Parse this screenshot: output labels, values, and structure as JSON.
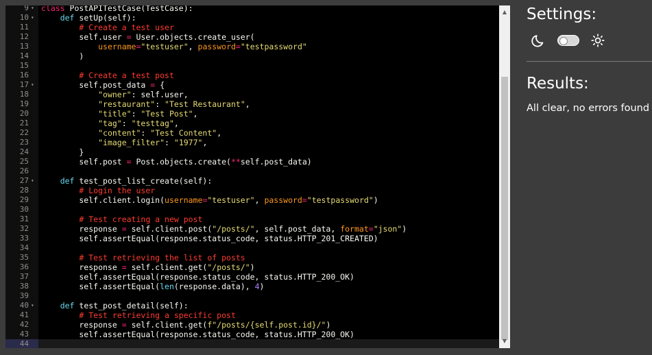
{
  "editor": {
    "lines": [
      {
        "n": "9",
        "fold": "▾",
        "segs": [
          [
            "kw",
            "class "
          ],
          [
            "",
            "PostAPITestCase(TestCase):"
          ]
        ]
      },
      {
        "n": "10",
        "fold": "▾",
        "segs": [
          [
            "",
            "    "
          ],
          [
            "k",
            "def "
          ],
          [
            "",
            "setUp(self):"
          ]
        ]
      },
      {
        "n": "11",
        "segs": [
          [
            "",
            "        "
          ],
          [
            "c",
            "# Create a test user"
          ]
        ]
      },
      {
        "n": "12",
        "segs": [
          [
            "",
            "        self.user "
          ],
          [
            "kw",
            "="
          ],
          [
            "",
            " User.objects.create_user("
          ]
        ]
      },
      {
        "n": "13",
        "segs": [
          [
            "",
            "            "
          ],
          [
            "p",
            "username"
          ],
          [
            "kw",
            "="
          ],
          [
            "s",
            "\"testuser\""
          ],
          [
            "",
            ", "
          ],
          [
            "p",
            "password"
          ],
          [
            "kw",
            "="
          ],
          [
            "s",
            "\"testpassword\""
          ]
        ]
      },
      {
        "n": "14",
        "segs": [
          [
            "",
            "        )"
          ]
        ]
      },
      {
        "n": "15",
        "segs": []
      },
      {
        "n": "16",
        "segs": [
          [
            "",
            "        "
          ],
          [
            "c",
            "# Create a test post"
          ]
        ]
      },
      {
        "n": "17",
        "fold": "▾",
        "segs": [
          [
            "",
            "        self.post_data "
          ],
          [
            "kw",
            "="
          ],
          [
            "",
            " {"
          ]
        ]
      },
      {
        "n": "18",
        "segs": [
          [
            "",
            "            "
          ],
          [
            "s",
            "\"owner\""
          ],
          [
            "",
            ": self.user,"
          ]
        ]
      },
      {
        "n": "19",
        "segs": [
          [
            "",
            "            "
          ],
          [
            "s",
            "\"restaurant\""
          ],
          [
            "",
            ": "
          ],
          [
            "s",
            "\"Test Restaurant\""
          ],
          [
            "",
            ","
          ]
        ]
      },
      {
        "n": "20",
        "segs": [
          [
            "",
            "            "
          ],
          [
            "s",
            "\"title\""
          ],
          [
            "",
            ": "
          ],
          [
            "s",
            "\"Test Post\""
          ],
          [
            "",
            ","
          ]
        ]
      },
      {
        "n": "21",
        "segs": [
          [
            "",
            "            "
          ],
          [
            "s",
            "\"tag\""
          ],
          [
            "",
            ": "
          ],
          [
            "s",
            "\"testtag\""
          ],
          [
            "",
            ","
          ]
        ]
      },
      {
        "n": "22",
        "segs": [
          [
            "",
            "            "
          ],
          [
            "s",
            "\"content\""
          ],
          [
            "",
            ": "
          ],
          [
            "s",
            "\"Test Content\""
          ],
          [
            "",
            ","
          ]
        ]
      },
      {
        "n": "23",
        "segs": [
          [
            "",
            "            "
          ],
          [
            "s",
            "\"image_filter\""
          ],
          [
            "",
            ": "
          ],
          [
            "s",
            "\"1977\""
          ],
          [
            "",
            ","
          ]
        ]
      },
      {
        "n": "24",
        "segs": [
          [
            "",
            "        }"
          ]
        ]
      },
      {
        "n": "25",
        "segs": [
          [
            "",
            "        self.post "
          ],
          [
            "kw",
            "="
          ],
          [
            "",
            " Post.objects.create("
          ],
          [
            "kw",
            "**"
          ],
          [
            "",
            "self.post_data)"
          ]
        ]
      },
      {
        "n": "26",
        "segs": []
      },
      {
        "n": "27",
        "fold": "▾",
        "segs": [
          [
            "",
            "    "
          ],
          [
            "k",
            "def "
          ],
          [
            "",
            "test_post_list_create(self):"
          ]
        ]
      },
      {
        "n": "28",
        "segs": [
          [
            "",
            "        "
          ],
          [
            "c",
            "# Login the user"
          ]
        ]
      },
      {
        "n": "29",
        "segs": [
          [
            "",
            "        self.client.login("
          ],
          [
            "p",
            "username"
          ],
          [
            "kw",
            "="
          ],
          [
            "s",
            "\"testuser\""
          ],
          [
            "",
            ", "
          ],
          [
            "p",
            "password"
          ],
          [
            "kw",
            "="
          ],
          [
            "s",
            "\"testpassword\""
          ],
          [
            "",
            ")"
          ]
        ]
      },
      {
        "n": "30",
        "segs": []
      },
      {
        "n": "31",
        "segs": [
          [
            "",
            "        "
          ],
          [
            "c",
            "# Test creating a new post"
          ]
        ]
      },
      {
        "n": "32",
        "segs": [
          [
            "",
            "        response "
          ],
          [
            "kw",
            "="
          ],
          [
            "",
            " self.client.post("
          ],
          [
            "s",
            "\"/posts/\""
          ],
          [
            "",
            ", self.post_data, "
          ],
          [
            "p",
            "format"
          ],
          [
            "kw",
            "="
          ],
          [
            "s",
            "\"json\""
          ],
          [
            "",
            ")"
          ]
        ]
      },
      {
        "n": "33",
        "segs": [
          [
            "",
            "        self.assertEqual(response.status_code, status.HTTP_201_CREATED)"
          ]
        ]
      },
      {
        "n": "34",
        "segs": []
      },
      {
        "n": "35",
        "segs": [
          [
            "",
            "        "
          ],
          [
            "c",
            "# Test retrieving the list of posts"
          ]
        ]
      },
      {
        "n": "36",
        "segs": [
          [
            "",
            "        response "
          ],
          [
            "kw",
            "="
          ],
          [
            "",
            " self.client.get("
          ],
          [
            "s",
            "\"/posts/\""
          ],
          [
            "",
            ")"
          ]
        ]
      },
      {
        "n": "37",
        "segs": [
          [
            "",
            "        self.assertEqual(response.status_code, status.HTTP_200_OK)"
          ]
        ]
      },
      {
        "n": "38",
        "segs": [
          [
            "",
            "        self.assertEqual("
          ],
          [
            "b",
            "len"
          ],
          [
            "",
            "(response.data), "
          ],
          [
            "n",
            "4"
          ],
          [
            "",
            ")"
          ]
        ]
      },
      {
        "n": "39",
        "segs": []
      },
      {
        "n": "40",
        "fold": "▾",
        "segs": [
          [
            "",
            "    "
          ],
          [
            "k",
            "def "
          ],
          [
            "",
            "test_post_detail(self):"
          ]
        ]
      },
      {
        "n": "41",
        "segs": [
          [
            "",
            "        "
          ],
          [
            "c",
            "# Test retrieving a specific post"
          ]
        ]
      },
      {
        "n": "42",
        "segs": [
          [
            "",
            "        response "
          ],
          [
            "kw",
            "="
          ],
          [
            "",
            " self.client.get("
          ],
          [
            "s",
            "f\"/posts/{self.post.id}/\""
          ],
          [
            "",
            ")"
          ]
        ]
      },
      {
        "n": "43",
        "segs": [
          [
            "",
            "        self.assertEqual(response.status_code, status.HTTP_200_OK)"
          ]
        ]
      },
      {
        "n": "44",
        "active": true,
        "segs": []
      }
    ]
  },
  "sidebar": {
    "settings_title": "Settings:",
    "results_title": "Results:",
    "results_text": "All clear, no errors found"
  },
  "icons": {
    "moon": "moon-icon",
    "sun": "sun-icon",
    "toggle": "theme-toggle"
  },
  "colors": {
    "editor_bg": "#000000",
    "panel_bg": "#3c3c3c",
    "comment": "#ff3b2f",
    "string": "#e6db74",
    "keyword": "#f92672",
    "def": "#66d9ef"
  }
}
